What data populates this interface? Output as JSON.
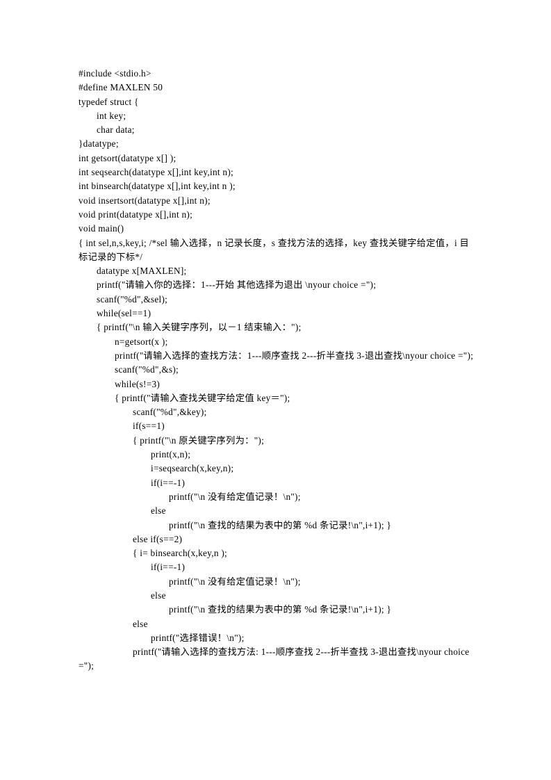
{
  "document": {
    "kind": "c-source-listing",
    "page_background": "#ffffff",
    "text_color": "#000000",
    "lines": [
      {
        "indent": 0,
        "text": "#include <stdio.h>"
      },
      {
        "indent": 0,
        "text": "#define MAXLEN 50"
      },
      {
        "indent": 0,
        "text": "typedef    struct {"
      },
      {
        "indent": 1,
        "text": "int key;"
      },
      {
        "indent": 1,
        "text": "char data;"
      },
      {
        "indent": 0,
        "text": "}datatype;"
      },
      {
        "indent": 0,
        "text": "int getsort(datatype x[] );"
      },
      {
        "indent": 0,
        "text": "int seqsearch(datatype x[],int key,int n);"
      },
      {
        "indent": 0,
        "text": "int binsearch(datatype x[],int key,int n );"
      },
      {
        "indent": 0,
        "text": "void insertsort(datatype x[],int n);"
      },
      {
        "indent": 0,
        "text": "void print(datatype x[],int n);"
      },
      {
        "indent": 0,
        "text": "void main()"
      },
      {
        "indent": 0,
        "hang": true,
        "text": "{     int sel,n,s,key,i;      /*sel 输入选择，n 记录长度，s 查找方法的选择，key 查找关键字给定值，i 目标记录的下标*/"
      },
      {
        "indent": 1,
        "text": "datatype x[MAXLEN];"
      },
      {
        "indent": 1,
        "text": "printf(\"请输入你的选择：1---开始  其他选择为退出  \\nyour choice =\");"
      },
      {
        "indent": 1,
        "text": "scanf(\"%d\",&sel);"
      },
      {
        "indent": 1,
        "text": "while(sel==1)"
      },
      {
        "indent": 1,
        "text": "{     printf(\"\\n 输入关键字序列，以－1 结束输入：\");"
      },
      {
        "indent": 2,
        "text": "n=getsort(x );"
      },
      {
        "indent": 2,
        "hang": true,
        "text": "printf(\"请输入选择的查找方法：1---顺序查找  2---折半查找  3-退出查找\\nyour choice =\");"
      },
      {
        "indent": 2,
        "text": "scanf(\"%d\",&s);"
      },
      {
        "indent": 2,
        "text": "while(s!=3)"
      },
      {
        "indent": 2,
        "text": "{     printf(\"请输入查找关键字给定值 key＝\");"
      },
      {
        "indent": 3,
        "text": "scanf(\"%d\",&key);"
      },
      {
        "indent": 3,
        "text": "if(s==1)"
      },
      {
        "indent": 3,
        "text": "{     printf(\"\\n 原关键字序列为：\");"
      },
      {
        "indent": 4,
        "text": "print(x,n);"
      },
      {
        "indent": 4,
        "text": "i=seqsearch(x,key,n);"
      },
      {
        "indent": 4,
        "text": "if(i==-1)"
      },
      {
        "indent": 5,
        "text": "printf(\"\\n 没有给定值记录！\\n\");"
      },
      {
        "indent": 4,
        "text": "else"
      },
      {
        "indent": 5,
        "text": "printf(\"\\n 查找的结果为表中的第  %d  条记录!\\n\",i+1);    }"
      },
      {
        "indent": 3,
        "text": "else if(s==2)"
      },
      {
        "indent": 3,
        "text": "{     i= binsearch(x,key,n );"
      },
      {
        "indent": 4,
        "text": "if(i==-1)"
      },
      {
        "indent": 5,
        "text": "printf(\"\\n 没有给定值记录！\\n\");"
      },
      {
        "indent": 4,
        "text": "else"
      },
      {
        "indent": 5,
        "text": "printf(\"\\n 查找的结果为表中的第  %d  条记录!\\n\",i+1);       }"
      },
      {
        "indent": 3,
        "text": "else"
      },
      {
        "indent": 4,
        "text": "printf(\"选择错误！\\n\");"
      },
      {
        "indent": 3,
        "hang": true,
        "text": "printf(\"请输入选择的查找方法: 1---顺序查找  2---折半查找  3-退出查找\\nyour choice =\");"
      }
    ]
  }
}
